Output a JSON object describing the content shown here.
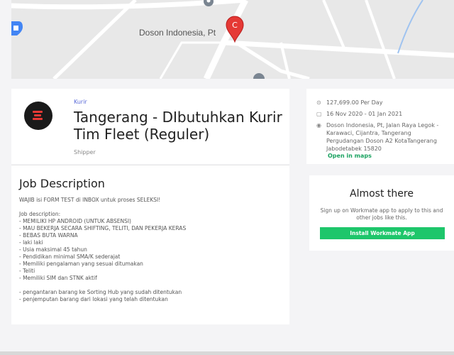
{
  "map": {
    "place_label": "Doson Indonesia, Pt",
    "pin_letter": "C",
    "colors": {
      "background": "#e8e8e8",
      "road": "#ffffff",
      "pin": "#e53935",
      "shop_pin": "#4285f4",
      "gray_pin": "#7a8591"
    }
  },
  "job": {
    "category": "Kurir",
    "title": "Tangerang - DIbutuhkan Kurir Tim Fleet (Reguler)",
    "company": "Shipper"
  },
  "info": {
    "salary": "127,699.00 Per Day",
    "dates": "16 Nov 2020 - 01 Jan 2021",
    "address": "Doson Indonesia, Pt, Jalan Raya Legok - Karawaci, Cijantra, Tangerang Pergudangan Doson A2 KotaTangerang Jabodetabek 15820",
    "open_maps": "Open in maps",
    "icons": [
      "money-icon",
      "calendar-icon",
      "location-pin-icon"
    ]
  },
  "description": {
    "heading": "Job Description",
    "intro": "WAJIB isi FORM TEST di INBOX untuk proses SELEKSI!",
    "list_heading": "Job description:",
    "requirements": [
      "- MEMILIKI HP ANDROID (UNTUK ABSENSI)",
      "- MAU BEKERJA SECARA SHIFTING, TELITI, DAN PEKERJA KERAS",
      "- BEBAS BUTA WARNA",
      "- laki laki",
      "- Usia maksimal 45 tahun",
      "- Pendidikan minimal SMA/K sederajat",
      "- Memiliki pengalaman yang sesuai ditumakan",
      "- Teliti",
      "- Memiliki SIM dan STNK aktif"
    ],
    "duties": [
      "- pengantaran barang ke Sorting Hub yang sudah ditentukan",
      "- penjemputan barang dari lokasi yang telah ditentukan"
    ]
  },
  "cta": {
    "title": "Almost there",
    "text": "Sign up on Workmate app to apply to this and other jobs like this.",
    "button": "Install Workmate App",
    "button_color": "#1ec66b"
  },
  "colors": {
    "page_bg": "#f4f4f6",
    "accent_link": "#5a6bd8",
    "logo_bg": "#1a1a1a",
    "logo_mark": "#e53935"
  }
}
